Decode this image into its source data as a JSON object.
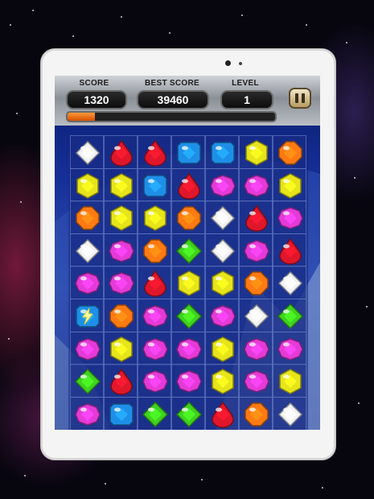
{
  "hud": {
    "score_label": "SCORE",
    "score_value": "1320",
    "best_label": "BEST SCORE",
    "best_value": "39460",
    "level_label": "LEVEL",
    "level_value": "1",
    "progress_fraction": 0.13
  },
  "board": {
    "rows": [
      [
        "white",
        "red",
        "red",
        "blue",
        "blue",
        "yellow",
        "orange"
      ],
      [
        "yellow",
        "yellow",
        "blue",
        "red",
        "magenta",
        "magenta",
        "yellow"
      ],
      [
        "orange",
        "yellow",
        "yellow",
        "orange",
        "white",
        "red",
        "magenta"
      ],
      [
        "white",
        "magenta",
        "orange",
        "green",
        "white",
        "magenta",
        "red"
      ],
      [
        "magenta",
        "magenta",
        "red",
        "yellow",
        "yellow",
        "orange",
        "white"
      ],
      [
        "blue-special",
        "orange",
        "magenta",
        "green",
        "magenta",
        "white",
        "green"
      ],
      [
        "magenta",
        "yellow",
        "magenta",
        "magenta",
        "yellow",
        "magenta",
        "magenta"
      ],
      [
        "green",
        "red",
        "magenta",
        "magenta",
        "yellow",
        "magenta",
        "yellow"
      ],
      [
        "magenta",
        "blue",
        "green",
        "green",
        "red",
        "orange",
        "white"
      ]
    ]
  },
  "colors": {
    "white": "#f2f2f2",
    "red": "#e0162a",
    "blue": "#1e8fe8",
    "yellow": "#e6e41a",
    "orange": "#ff7a12",
    "magenta": "#e53ad8",
    "green": "#3fd21e",
    "accent_progress": "#ff8a2a"
  }
}
